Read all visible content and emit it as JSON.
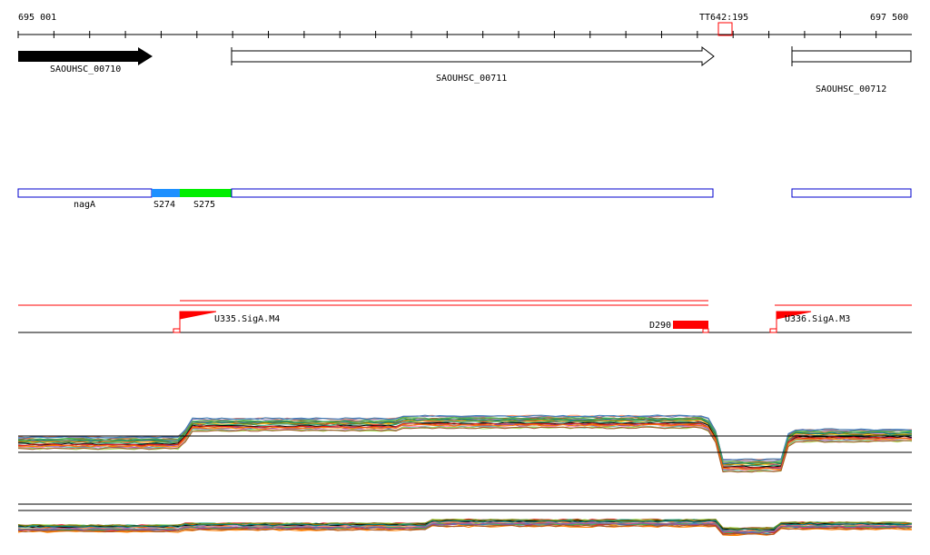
{
  "ruler": {
    "start_label": "695 001",
    "end_label": "697 500",
    "terminator_label": "TT642:195"
  },
  "genes": [
    {
      "name": "SAOUHSC_00710",
      "strand": "+",
      "filled": true
    },
    {
      "name": "SAOUHSC_00711",
      "strand": "+",
      "filled": false
    },
    {
      "name": "SAOUHSC_00712",
      "strand": "+",
      "filled": false
    }
  ],
  "segments": [
    {
      "name": "nagA",
      "color": "#ffffff"
    },
    {
      "name": "S274",
      "color": "#1e90ff"
    },
    {
      "name": "S275",
      "color": "#00ee00"
    }
  ],
  "promoters": [
    {
      "name": "U335.SigA.M4"
    },
    {
      "name": "D290"
    },
    {
      "name": "U336.SigA.M3"
    }
  ],
  "colors": {
    "accent": "#ff0000",
    "segment_border": "#0000cc"
  }
}
